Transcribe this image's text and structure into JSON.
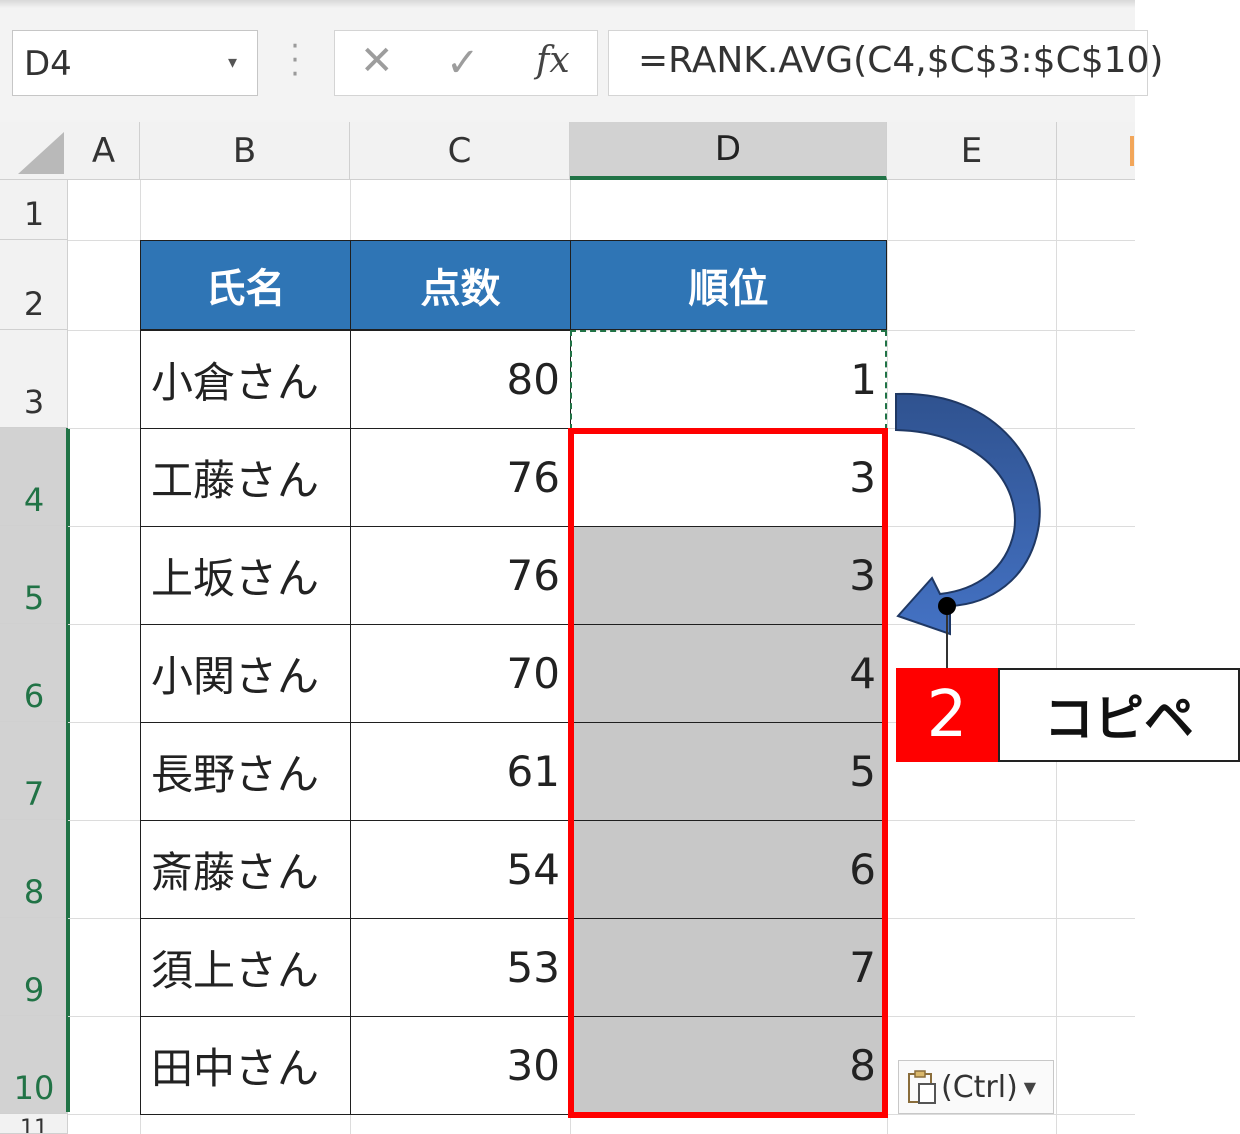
{
  "formula_bar": {
    "name_box": "D4",
    "cancel_icon": "✕",
    "enter_icon": "✓",
    "fx_icon": "fx",
    "formula": "=RANK.AVG(C4,$C$3:$C$10)"
  },
  "columns": [
    "A",
    "B",
    "C",
    "D",
    "E"
  ],
  "rows": [
    "1",
    "2",
    "3",
    "4",
    "5",
    "6",
    "7",
    "8",
    "9",
    "10",
    "11"
  ],
  "selected_column": "D",
  "table": {
    "headers": [
      "氏名",
      "点数",
      "順位"
    ],
    "records": [
      {
        "name": "小倉さん",
        "score": "80",
        "rank": "1"
      },
      {
        "name": "工藤さん",
        "score": "76",
        "rank": "3"
      },
      {
        "name": "上坂さん",
        "score": "76",
        "rank": "3"
      },
      {
        "name": "小関さん",
        "score": "70",
        "rank": "4"
      },
      {
        "name": "長野さん",
        "score": "61",
        "rank": "5"
      },
      {
        "name": "斎藤さん",
        "score": "54",
        "rank": "6"
      },
      {
        "name": "須上さん",
        "score": "53",
        "rank": "7"
      },
      {
        "name": "田中さん",
        "score": "30",
        "rank": "8"
      }
    ]
  },
  "callout": {
    "step_number": "2",
    "label": "コピペ"
  },
  "paste_options": {
    "label": "(Ctrl)",
    "icon": "clipboard-icon"
  },
  "colors": {
    "header_blue": "#2f75b5",
    "excel_green": "#217346",
    "highlight_red": "#ff0000",
    "selection_gray": "#c8c8c8",
    "arrow_blue": "#4472c4"
  }
}
